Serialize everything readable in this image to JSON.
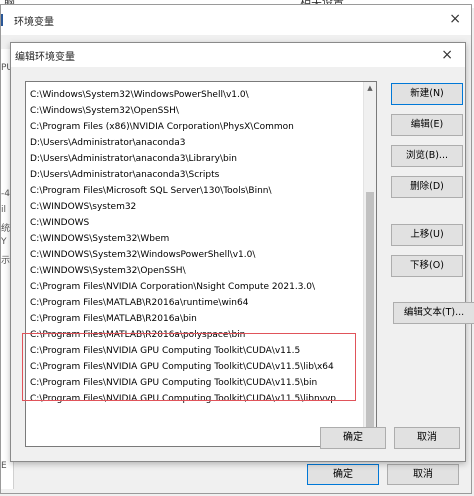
{
  "background": {
    "top_left_text": "脑",
    "top_right_text": "相关设置",
    "left_fragments": [
      "PU",
      "-4",
      "il",
      "统",
      "Y",
      "示",
      "E"
    ]
  },
  "outer_window": {
    "title": "环境变量",
    "close_icon": "×",
    "ok_label": "确定",
    "cancel_label": "取消"
  },
  "dialog": {
    "title": "编辑环境变量",
    "close_icon": "×",
    "paths": [
      "C:\\Windows\\System32\\WindowsPowerShell\\v1.0\\",
      "C:\\Windows\\System32\\OpenSSH\\",
      "C:\\Program Files (x86)\\NVIDIA Corporation\\PhysX\\Common",
      "D:\\Users\\Administrator\\anaconda3",
      "D:\\Users\\Administrator\\anaconda3\\Library\\bin",
      "D:\\Users\\Administrator\\anaconda3\\Scripts",
      "C:\\Program Files\\Microsoft SQL Server\\130\\Tools\\Binn\\",
      "C:\\WINDOWS\\system32",
      "C:\\WINDOWS",
      "C:\\WINDOWS\\System32\\Wbem",
      "C:\\WINDOWS\\System32\\WindowsPowerShell\\v1.0\\",
      "C:\\WINDOWS\\System32\\OpenSSH\\",
      "C:\\Program Files\\NVIDIA Corporation\\Nsight Compute 2021.3.0\\",
      "C:\\Program Files\\MATLAB\\R2016a\\runtime\\win64",
      "C:\\Program Files\\MATLAB\\R2016a\\bin",
      "C:\\Program Files\\MATLAB\\R2016a\\polyspace\\bin",
      "C:\\Program Files\\NVIDIA GPU Computing Toolkit\\CUDA\\v11.5",
      "C:\\Program Files\\NVIDIA GPU Computing Toolkit\\CUDA\\v11.5\\lib\\x64",
      "C:\\Program Files\\NVIDIA GPU Computing Toolkit\\CUDA\\v11.5\\bin",
      "C:\\Program Files\\NVIDIA GPU Computing Toolkit\\CUDA\\v11.5\\libnvvp"
    ],
    "buttons": {
      "new": "新建(N)",
      "edit": "编辑(E)",
      "browse": "浏览(B)...",
      "delete": "删除(D)",
      "move_up": "上移(U)",
      "move_down": "下移(O)",
      "edit_text": "编辑文本(T)..."
    },
    "ok_label": "确定",
    "cancel_label": "取消"
  },
  "colors": {
    "highlight_border": "#e0535a",
    "focus_border": "#0078d7"
  }
}
